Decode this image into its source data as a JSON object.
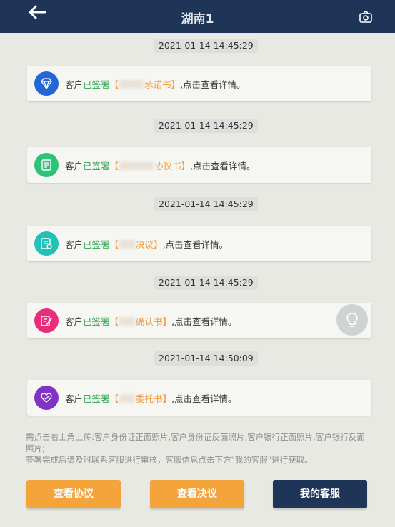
{
  "header": {
    "title": "湖南1",
    "back_icon": "back-arrow-icon",
    "camera_icon": "camera-icon"
  },
  "messages": [
    {
      "timestamp": "2021-01-14 14:45:29",
      "prefix": "客户",
      "status": "已签署",
      "open": "【",
      "doc": "承诺书",
      "close": "】",
      "suffix": ",点击查看详情。",
      "icon": "diamond-icon",
      "color": "#2367d6"
    },
    {
      "timestamp": "2021-01-14 14:45:29",
      "prefix": "客户",
      "status": "已签署",
      "open": "【",
      "doc": "协议书",
      "close": "】",
      "suffix": ",点击查看详情。",
      "icon": "document-icon",
      "color": "#2ec279"
    },
    {
      "timestamp": "2021-01-14 14:45:29",
      "prefix": "客户",
      "status": "已签署",
      "open": "【",
      "doc": "决议",
      "close": "】",
      "suffix": ",点击查看详情。",
      "icon": "resolution-icon",
      "color": "#21c1b7"
    },
    {
      "timestamp": "2021-01-14 14:45:29",
      "prefix": "客户",
      "status": "已签署",
      "open": "【",
      "doc": "确认书",
      "close": "】",
      "suffix": ",点击查看详情。",
      "icon": "edit-document-icon",
      "color": "#e72d7c"
    },
    {
      "timestamp": "2021-01-14 14:50:09",
      "prefix": "客户",
      "status": "已签署",
      "open": "【",
      "doc": "委托书",
      "close": "】",
      "suffix": ",点击查看详情。",
      "icon": "handshake-icon",
      "color": "#8134c4"
    }
  ],
  "notes": {
    "line1": "需点击右上角上传:客户身份证正面照片,客户身份证反面照片,客户银行正面照片,客户银行反面照片;",
    "line2": "签署完成后请及时联系客服进行审核，客服信息点击下方\"我的客服\"进行获取。"
  },
  "buttons": {
    "view_agreement": "查看协议",
    "view_resolution": "查看决议",
    "my_service": "我的客服"
  },
  "floating": {
    "icon": "lightbulb-icon"
  },
  "colors": {
    "header_bg": "#1f3557",
    "signed_green": "#2ea44f",
    "doc_orange": "#ef9a3a",
    "button_orange": "#f3a53c",
    "button_navy": "#1f3557"
  }
}
